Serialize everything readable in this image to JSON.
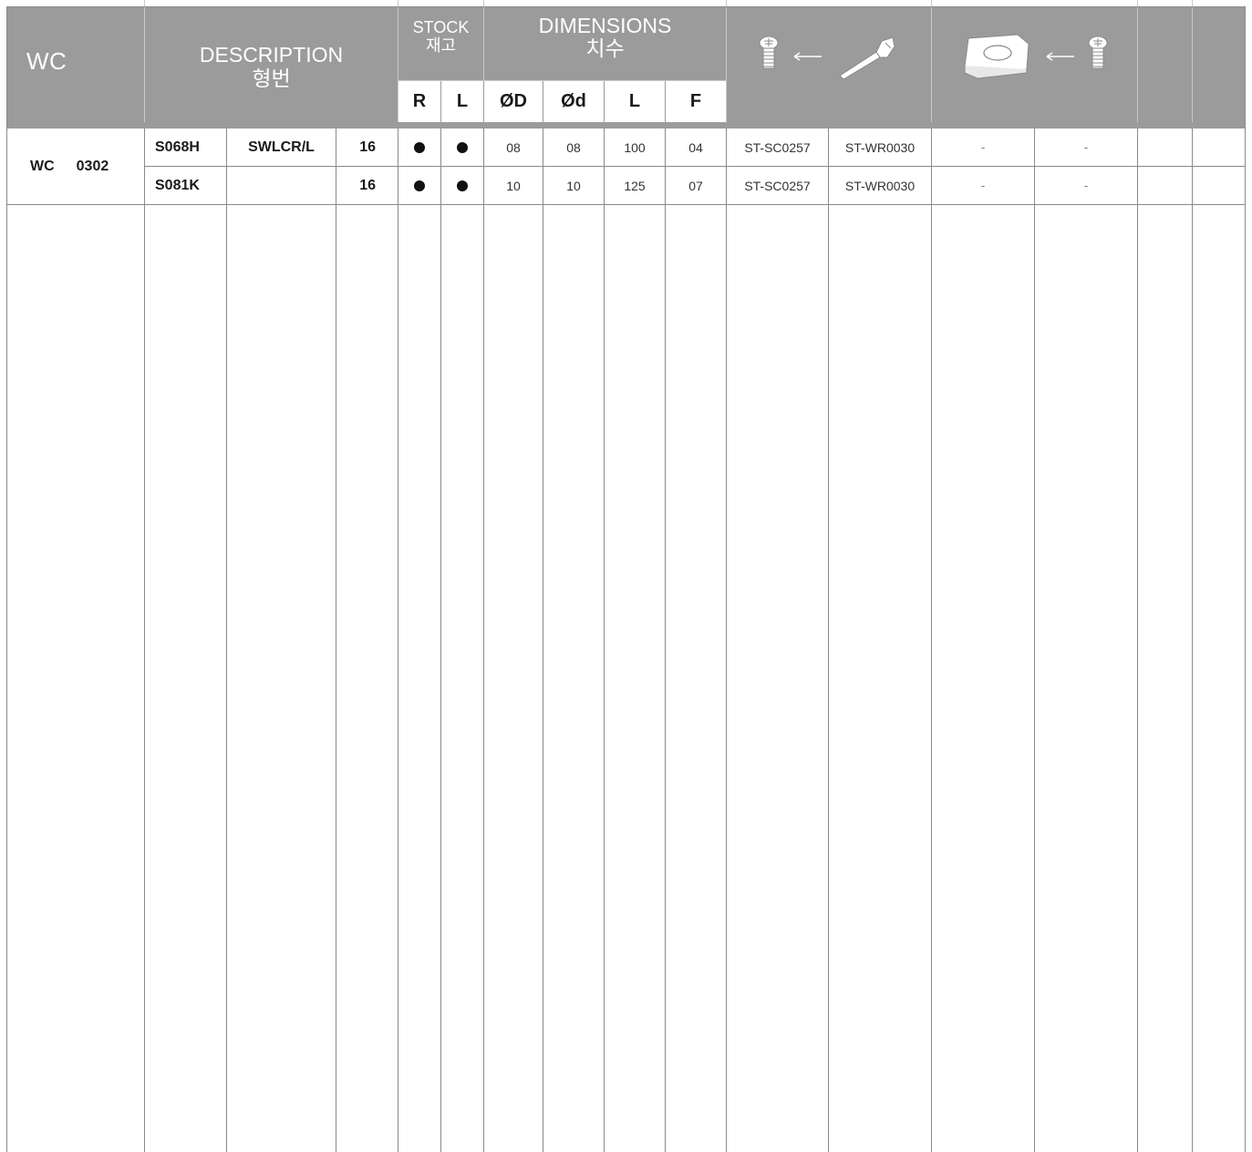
{
  "header": {
    "series_code": "WC",
    "description": {
      "en": "DESCRIPTION",
      "ko": "형번"
    },
    "stock": {
      "en": "STOCK",
      "ko": "재고",
      "r": "R",
      "l": "L"
    },
    "dimensions": {
      "en": "DIMENSIONS",
      "ko": "치수",
      "od": "ØD",
      "sd": "Ød",
      "l": "L",
      "f": "F"
    },
    "parts_icons": [
      "screw-icon",
      "wrench-icon",
      "insert-icon",
      "screw-icon"
    ]
  },
  "group": {
    "label_a": "WC",
    "label_b": "0302"
  },
  "rows": [
    {
      "code": "S068H",
      "type": "SWLCR/L",
      "size": "16",
      "r": "●",
      "l": "●",
      "od": "08",
      "sd": "08",
      "len": "100",
      "f": "04",
      "screw": "ST-SC0257",
      "wrench": "ST-WR0030",
      "shim": "-",
      "shim_screw": "-"
    },
    {
      "code": "S081K",
      "type": "",
      "size": "16",
      "r": "●",
      "l": "●",
      "od": "10",
      "sd": "10",
      "len": "125",
      "f": "07",
      "screw": "ST-SC0257",
      "wrench": "ST-WR0030",
      "shim": "-",
      "shim_screw": "-"
    }
  ]
}
